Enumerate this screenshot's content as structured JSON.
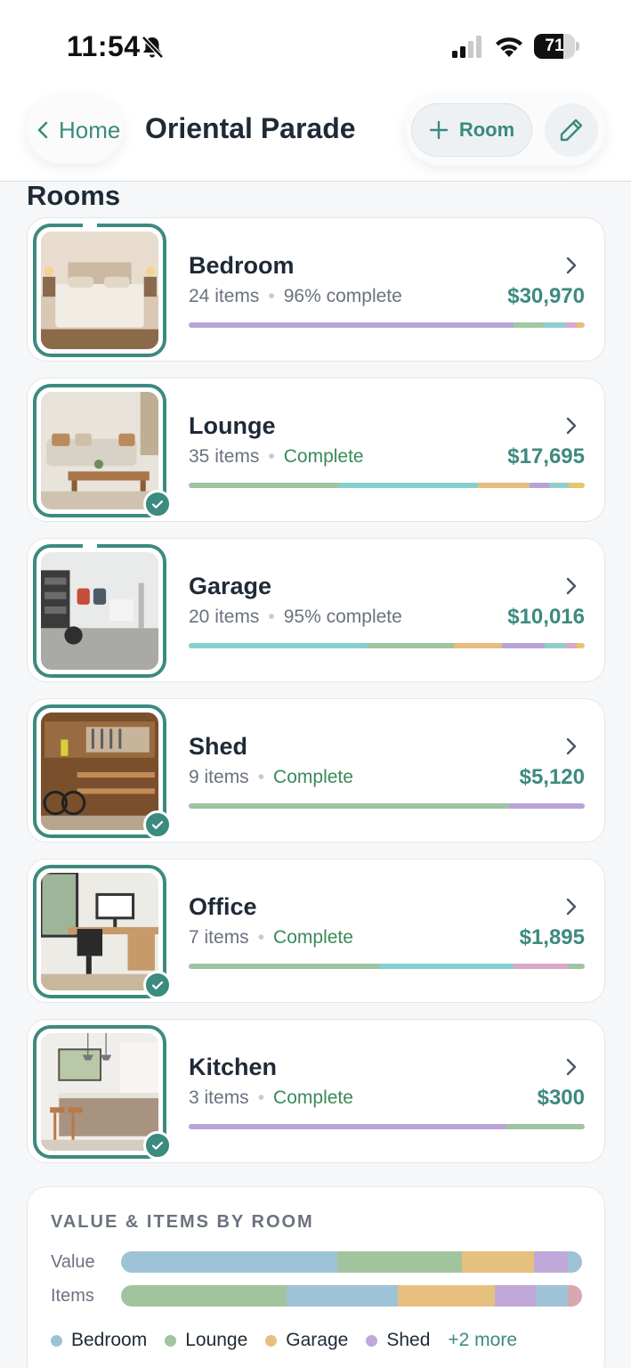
{
  "status_bar": {
    "time": "11:54",
    "battery": "71",
    "battery_level": 0.71
  },
  "header": {
    "back_label": "Home",
    "title": "Oriental Parade",
    "add_room_label": "Room"
  },
  "section_title": "Rooms",
  "colors": {
    "accent": "#3d8a7e",
    "complete_text": "#3a8a5a",
    "palette": [
      "#b8a3d8",
      "#9fc4a2",
      "#86cfd0",
      "#e6bd7c",
      "#d8a8c7",
      "#e2c86a",
      "#9ec3d6"
    ]
  },
  "rooms": [
    {
      "name": "Bedroom",
      "items": "24 items",
      "status": "96% complete",
      "complete": false,
      "value": "$30,970",
      "photo_icon": "bedroom-photo",
      "bar": [
        {
          "pct": 82,
          "color": "#b9a3da"
        },
        {
          "pct": 8,
          "color": "#a1c9a4"
        },
        {
          "pct": 5,
          "color": "#89d0d0"
        },
        {
          "pct": 3,
          "color": "#d8a8c7"
        },
        {
          "pct": 2,
          "color": "#e6bd7c"
        }
      ]
    },
    {
      "name": "Lounge",
      "items": "35 items",
      "status": "Complete",
      "complete": true,
      "value": "$17,695",
      "photo_icon": "lounge-photo",
      "bar": [
        {
          "pct": 38,
          "color": "#9fc4a2"
        },
        {
          "pct": 35,
          "color": "#86cfd0"
        },
        {
          "pct": 13,
          "color": "#e6bd7c"
        },
        {
          "pct": 5,
          "color": "#b8a3d8"
        },
        {
          "pct": 5,
          "color": "#8fcfc8"
        },
        {
          "pct": 4,
          "color": "#e2c86a"
        }
      ]
    },
    {
      "name": "Garage",
      "items": "20 items",
      "status": "95% complete",
      "complete": false,
      "value": "$10,016",
      "photo_icon": "garage-photo",
      "bar": [
        {
          "pct": 45,
          "color": "#86cfd0"
        },
        {
          "pct": 22,
          "color": "#9fc4a2"
        },
        {
          "pct": 12,
          "color": "#e6bd7c"
        },
        {
          "pct": 11,
          "color": "#b8a3d8"
        },
        {
          "pct": 5,
          "color": "#8fcfc8"
        },
        {
          "pct": 3,
          "color": "#d8a8c7"
        },
        {
          "pct": 2,
          "color": "#e2c86a"
        }
      ]
    },
    {
      "name": "Shed",
      "items": "9 items",
      "status": "Complete",
      "complete": true,
      "value": "$5,120",
      "photo_icon": "shed-photo",
      "bar": [
        {
          "pct": 81,
          "color": "#9fc4a2"
        },
        {
          "pct": 19,
          "color": "#b8a3d8"
        }
      ]
    },
    {
      "name": "Office",
      "items": "7 items",
      "status": "Complete",
      "complete": true,
      "value": "$1,895",
      "photo_icon": "office-photo",
      "bar": [
        {
          "pct": 48,
          "color": "#9fc4a2"
        },
        {
          "pct": 34,
          "color": "#86cfd0"
        },
        {
          "pct": 14,
          "color": "#d8a8c7"
        },
        {
          "pct": 4,
          "color": "#9fc4a2"
        }
      ]
    },
    {
      "name": "Kitchen",
      "items": "3 items",
      "status": "Complete",
      "complete": true,
      "value": "$300",
      "photo_icon": "kitchen-photo",
      "bar": [
        {
          "pct": 80,
          "color": "#b8a3d8"
        },
        {
          "pct": 20,
          "color": "#9fc4a2"
        }
      ]
    }
  ],
  "summary": {
    "title": "VALUE & ITEMS BY ROOM",
    "value_label": "Value",
    "items_label": "Items",
    "value_bar": [
      {
        "pct": 47,
        "color": "#9ec3d6"
      },
      {
        "pct": 27,
        "color": "#a1c49e"
      },
      {
        "pct": 15.5,
        "color": "#e6c07e"
      },
      {
        "pct": 7.5,
        "color": "#c0a8d8"
      },
      {
        "pct": 3,
        "color": "#9ec3d6"
      }
    ],
    "items_bar": [
      {
        "pct": 36,
        "color": "#a1c49e"
      },
      {
        "pct": 24,
        "color": "#9ec3d6"
      },
      {
        "pct": 21,
        "color": "#e6c07e"
      },
      {
        "pct": 9,
        "color": "#c0a8d8"
      },
      {
        "pct": 7,
        "color": "#9ec3d6"
      },
      {
        "pct": 3,
        "color": "#d8a8b0"
      }
    ],
    "legend": [
      {
        "label": "Bedroom",
        "color": "#9ec3d6"
      },
      {
        "label": "Lounge",
        "color": "#a1c49e"
      },
      {
        "label": "Garage",
        "color": "#e6c07e"
      },
      {
        "label": "Shed",
        "color": "#c0a8d8"
      }
    ],
    "more_label": "+2 more"
  }
}
